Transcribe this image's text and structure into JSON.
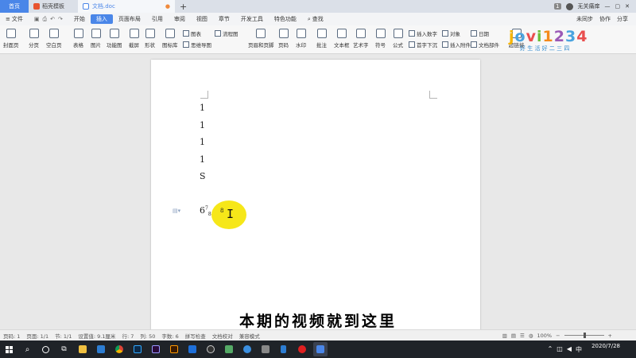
{
  "tabs": {
    "home": "首页",
    "template": "稻壳模板",
    "doc": "文档.doc",
    "new": "+"
  },
  "user": {
    "badge": "1",
    "name": "无关痛痒"
  },
  "menu": {
    "file": "文件",
    "items": [
      "开始",
      "插入",
      "页面布局",
      "引用",
      "审阅",
      "视图",
      "章节",
      "开发工具",
      "特色功能"
    ],
    "active": "插入",
    "search": "查找",
    "right": [
      "未同步",
      "协作",
      "分享"
    ]
  },
  "ribbon": {
    "large": [
      "封面页",
      "分页",
      "空白页",
      "表格",
      "图片",
      "功能图",
      "截屏",
      "形状",
      "图标库",
      "页眉和页脚",
      "页码",
      "水印",
      "批注",
      "文本框",
      "艺术字",
      "符号",
      "公式",
      "超链接"
    ],
    "small": [
      "图表",
      "流程图",
      "思维导图",
      "插入数字",
      "首字下沉",
      "对象",
      "插入附件",
      "日期",
      "文档部件"
    ]
  },
  "watermark": {
    "brand": "jovi1234",
    "tagline": "好 生 活 好 二 三 四"
  },
  "document": {
    "lines": [
      "1",
      "1",
      "1",
      "1",
      "S"
    ],
    "last_line_base": "6",
    "last_sup": "7",
    "last_sub": "8",
    "note": "8"
  },
  "subtitle": "本期的视频就到这里",
  "status": {
    "page": "页码: 1",
    "pages": "页面: 1/1",
    "section": "节: 1/1",
    "setting": "设置值: 9.1厘米",
    "row": "行: 7",
    "col": "列: 50",
    "words": "字数: 6",
    "spell": "拼写检查",
    "proof": "文档校对",
    "compat": "兼容模式",
    "zoom": "100%"
  },
  "clock": {
    "time": "",
    "date": "2020/7/28"
  },
  "colors": {
    "accent": "#4a86e8",
    "highlight": "#f5e400",
    "taskbar": "#1f2328"
  }
}
